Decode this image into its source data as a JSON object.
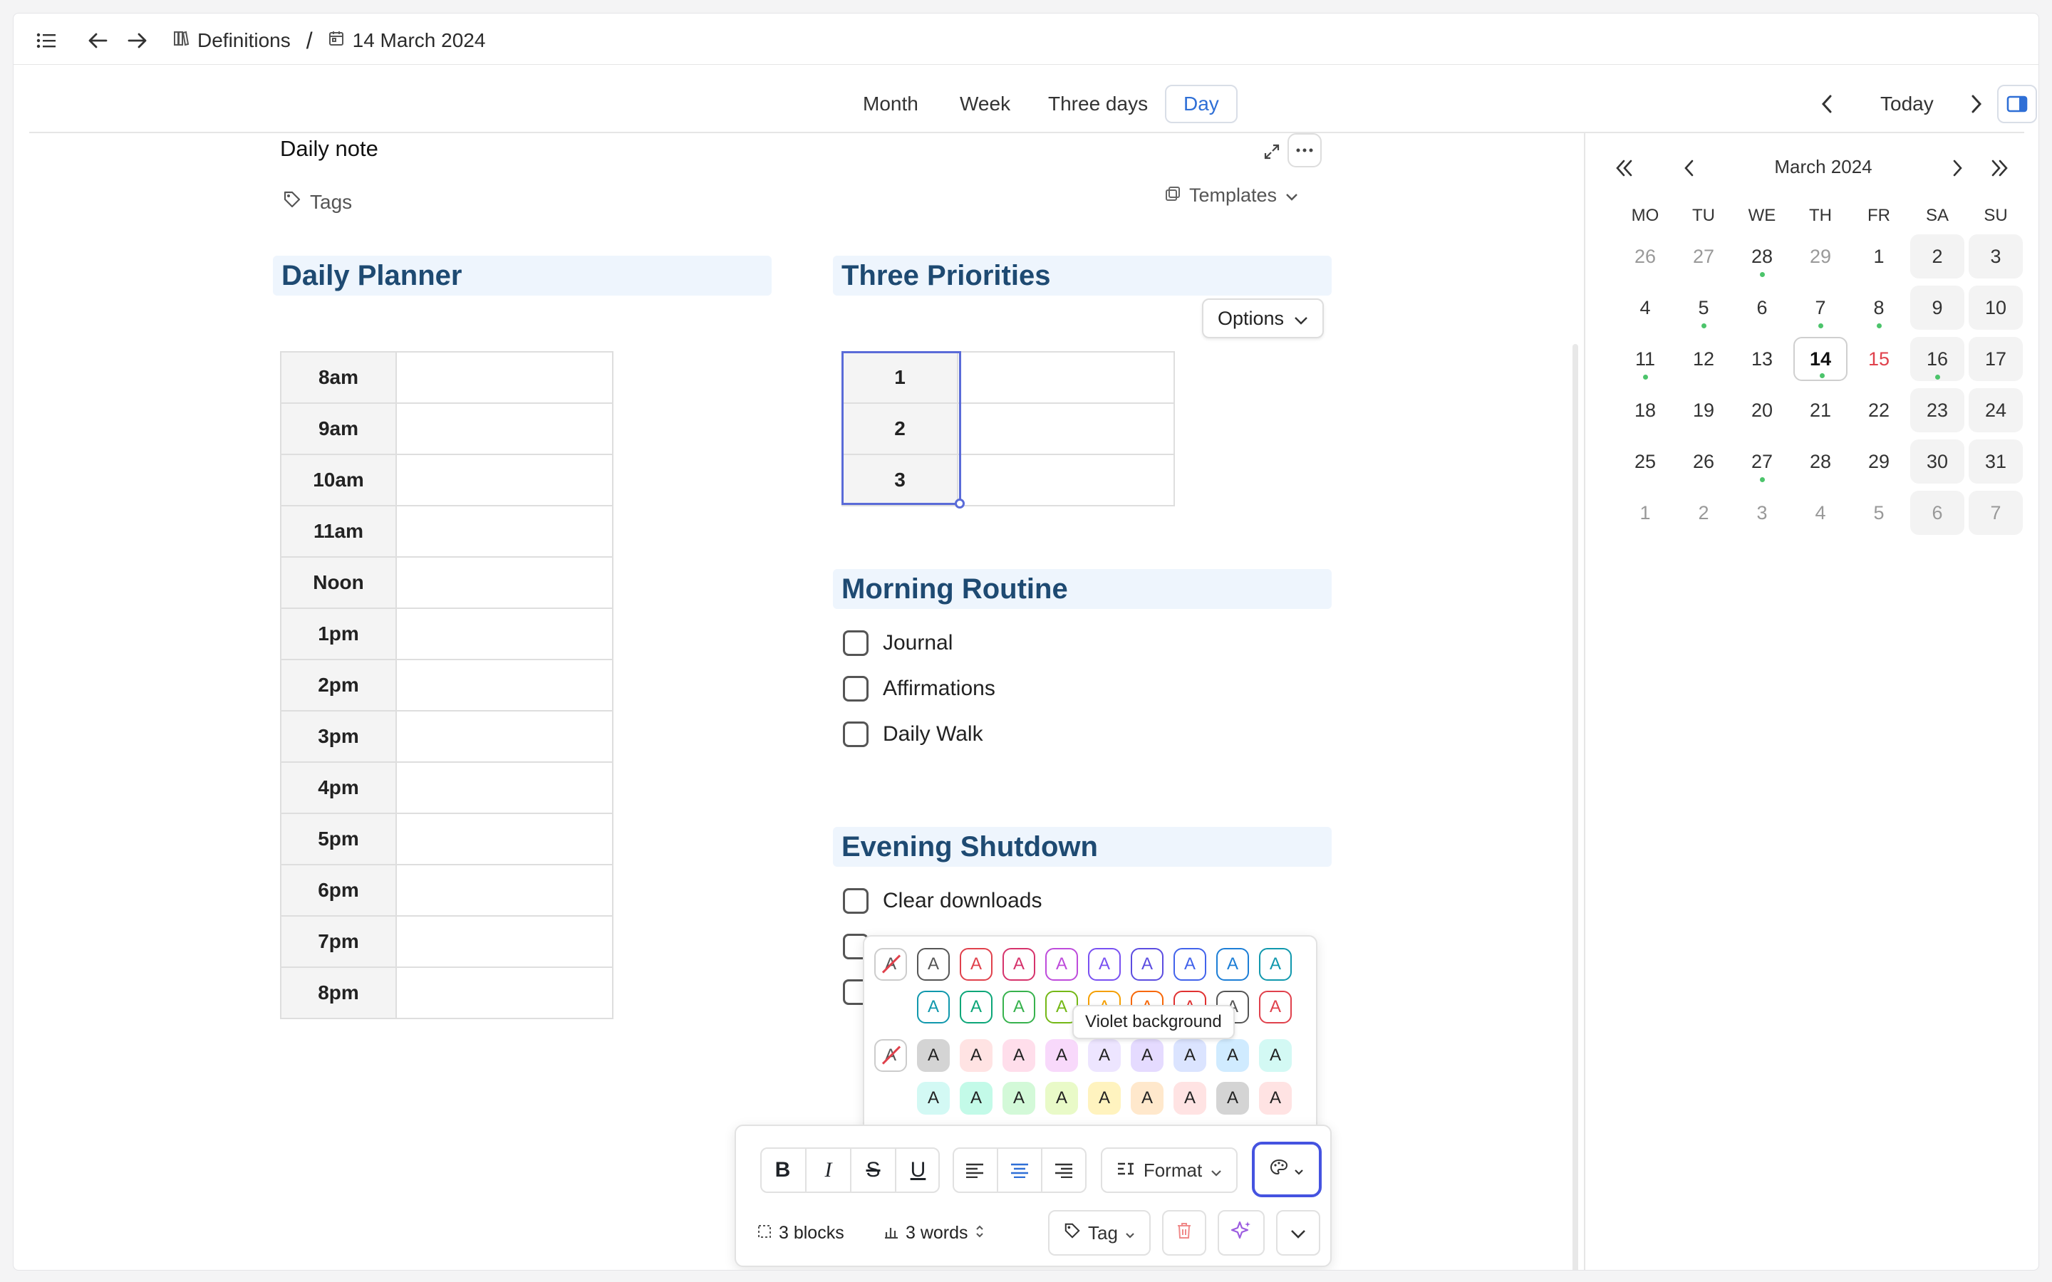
{
  "breadcrumb": {
    "parent": "Definitions",
    "separator": "/",
    "current": "14 March 2024"
  },
  "views": {
    "tabs": [
      "Month",
      "Week",
      "Three days",
      "Day"
    ],
    "active": "Day",
    "today_label": "Today"
  },
  "note": {
    "title": "Daily note",
    "tags_label": "Tags",
    "templates_label": "Templates",
    "options_label": "Options"
  },
  "planner": {
    "heading": "Daily Planner",
    "hours": [
      "8am",
      "9am",
      "10am",
      "11am",
      "Noon",
      "1pm",
      "2pm",
      "3pm",
      "4pm",
      "5pm",
      "6pm",
      "7pm",
      "8pm"
    ]
  },
  "priorities": {
    "heading": "Three Priorities",
    "rows": [
      "1",
      "2",
      "3"
    ]
  },
  "morning": {
    "heading": "Morning Routine",
    "items": [
      "Journal",
      "Affirmations",
      "Daily Walk"
    ]
  },
  "evening": {
    "heading": "Evening Shutdown",
    "items": [
      "Clear downloads"
    ]
  },
  "color_popup": {
    "tooltip": "Violet background",
    "letter": "A",
    "text_colors": [
      "#555555",
      "#e0414c",
      "#d6336c",
      "#be4bdb",
      "#7950f2",
      "#5c4de0",
      "#4263eb",
      "#1c7ed6",
      "#1098ad",
      "#0ca678",
      "#37b24d",
      "#74b816",
      "#f59f00",
      "#f76707",
      "#e03131"
    ],
    "bg_colors": [
      "#d4d4d4",
      "#ffe3e3",
      "#ffdeeb",
      "#f8d9fb",
      "#ede5ff",
      "#e5dbff",
      "#dbe4ff",
      "#d0ebff",
      "#d3f9f4",
      "#c3fae8",
      "#d3f9d8",
      "#e9fac8",
      "#fff3bf",
      "#ffe8cc",
      "#ffe3e3"
    ]
  },
  "toolbar": {
    "format_label": "Format",
    "blocks_label": "3 blocks",
    "words_label": "3 words",
    "tag_label": "Tag"
  },
  "calendar": {
    "month_label": "March 2024",
    "weekdays": [
      "MO",
      "TU",
      "WE",
      "TH",
      "FR",
      "SA",
      "SU"
    ],
    "weeks": [
      [
        "26",
        "27",
        "28",
        "29",
        "1",
        "2",
        "3"
      ],
      [
        "4",
        "5",
        "6",
        "7",
        "8",
        "9",
        "10"
      ],
      [
        "11",
        "12",
        "13",
        "14",
        "15",
        "16",
        "17"
      ],
      [
        "18",
        "19",
        "20",
        "21",
        "22",
        "23",
        "24"
      ],
      [
        "25",
        "26",
        "27",
        "28",
        "29",
        "30",
        "31"
      ],
      [
        "1",
        "2",
        "3",
        "4",
        "5",
        "6",
        "7"
      ]
    ],
    "selected": "14",
    "highlight_red": "15",
    "colors": {
      "accent": "#2f6fd6",
      "dot": "#4cc46b",
      "red": "#e0414c"
    }
  }
}
